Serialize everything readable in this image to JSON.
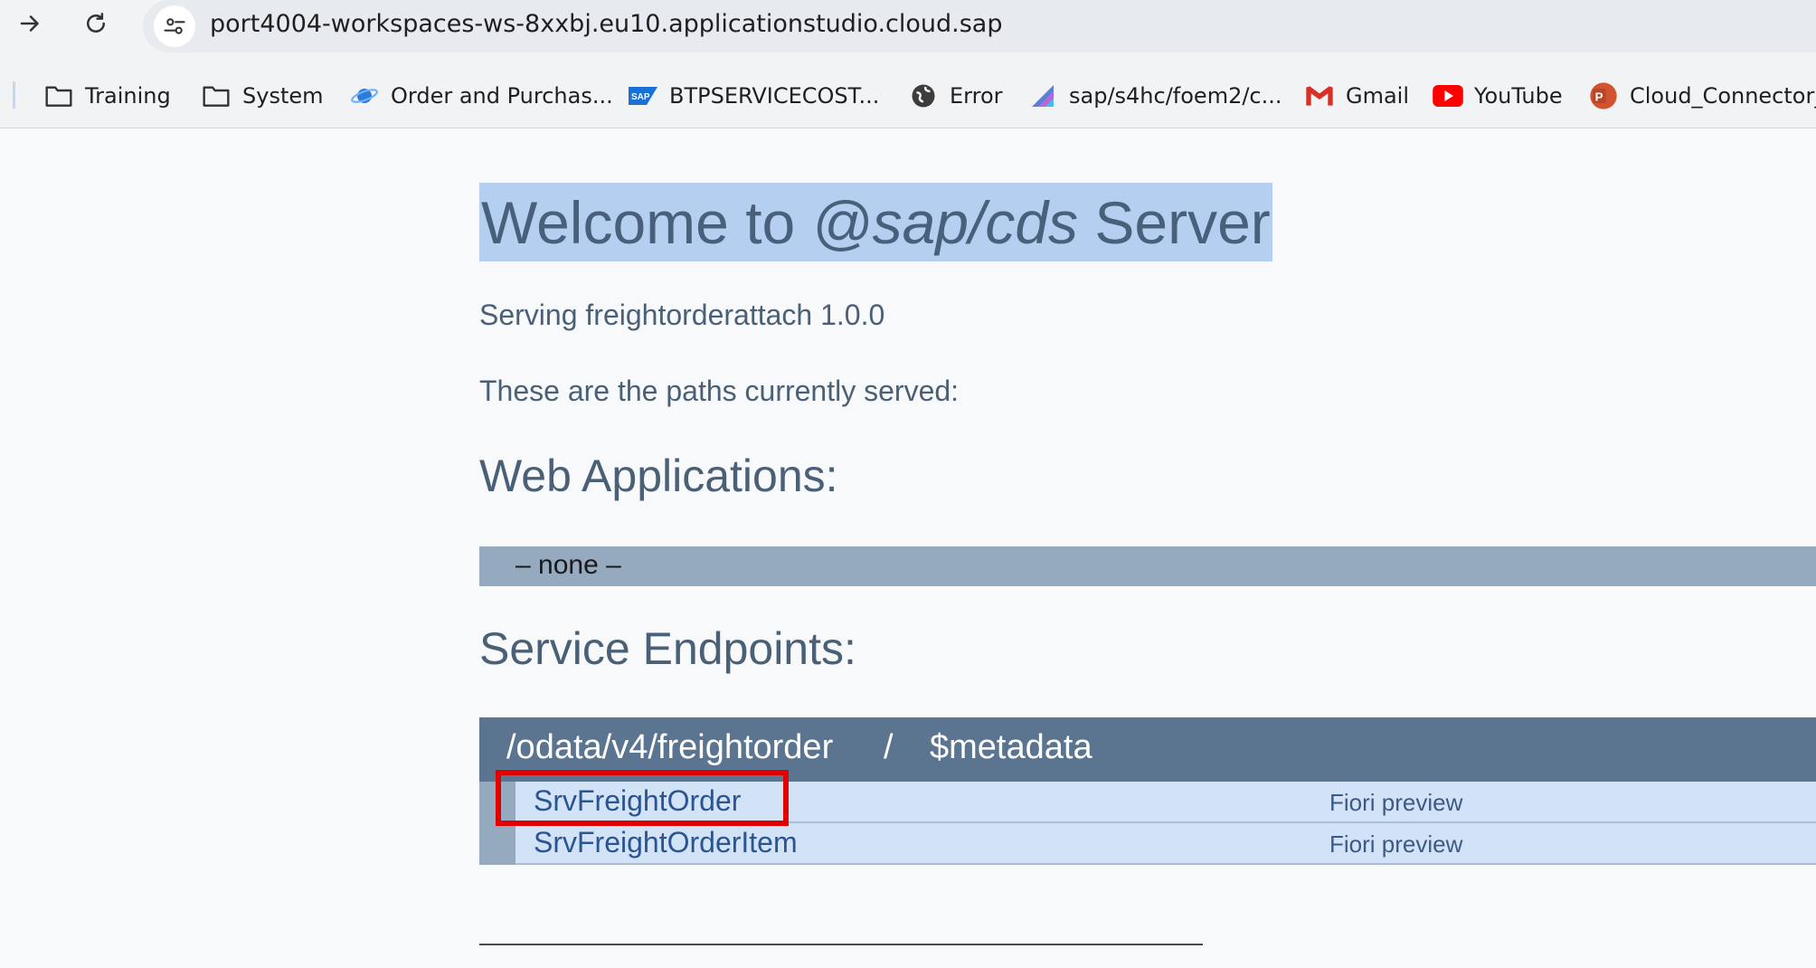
{
  "browser": {
    "url": "port4004-workspaces-ws-8xxbj.eu10.applicationstudio.cloud.sap",
    "bookmarks": [
      {
        "label": "Training",
        "icon": "folder-icon"
      },
      {
        "label": "System",
        "icon": "folder-icon"
      },
      {
        "label": "Order and Purchas...",
        "icon": "planet-icon"
      },
      {
        "label": "BTPSERVICECOST...",
        "icon": "sap-logo-icon"
      },
      {
        "label": "Error",
        "icon": "globe-icon"
      },
      {
        "label": "sap/s4hc/foem2/c...",
        "icon": "app-icon"
      },
      {
        "label": "Gmail",
        "icon": "gmail-icon"
      },
      {
        "label": "YouTube",
        "icon": "youtube-icon"
      },
      {
        "label": "Cloud_Connector_",
        "icon": "powerpoint-icon"
      }
    ]
  },
  "page": {
    "title_prefix": "Welcome to ",
    "title_em": "@sap/cds",
    "title_suffix": " Server",
    "serving": "Serving freightorderattach 1.0.0",
    "paths_intro": "These are the paths currently served:",
    "web_apps_heading": "Web Applications:",
    "web_apps_none": "– none –",
    "service_endpoints_heading": "Service Endpoints:",
    "service": {
      "path": "/odata/v4/freightorder",
      "separator": "/",
      "metadata": "$metadata",
      "entities": [
        {
          "name": "SrvFreightOrder",
          "preview": "Fiori preview"
        },
        {
          "name": "SrvFreightOrderItem",
          "preview": "Fiori preview"
        }
      ]
    }
  },
  "colors": {
    "title_highlight": "#b5cff0",
    "service_header": "#5b7591",
    "entity_row": "#d2e3f8",
    "annotation_box": "#e00000"
  }
}
